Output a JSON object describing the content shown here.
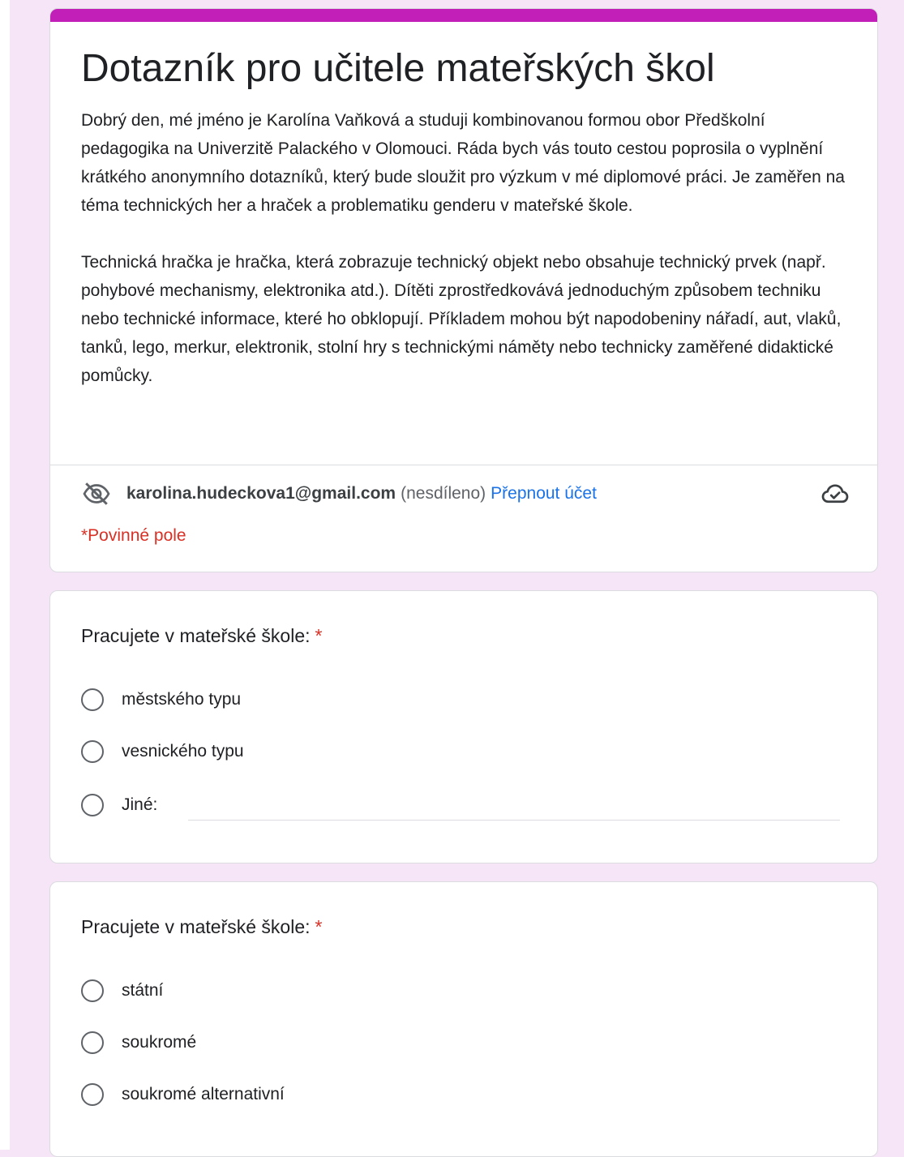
{
  "theme": {
    "accent": "#c21eb8",
    "background": "#f6e4f7",
    "link": "#1a73e8",
    "required": "#d93025"
  },
  "form": {
    "title": "Dotazník pro učitele mateřských škol",
    "description": [
      "Dobrý den, mé jméno je Karolína Vaňková a studuji kombinovanou formou obor Předškolní pedagogika na Univerzitě Palackého v Olomouci. Ráda bych vás touto cestou poprosila o vyplnění krátkého anonymního dotazníků, který bude sloužit pro výzkum v mé diplomové práci. Je zaměřen na téma technických her a hraček a problematiku genderu v mateřské škole.",
      "Technická hračka je hračka, která zobrazuje technický objekt nebo obsahuje technický prvek (např. pohybové mechanismy, elektronika atd.). Dítěti zprostředkovává jednoduchým způsobem techniku nebo technické informace, které ho obklopují. Příkladem mohou být napodobeniny nářadí, aut, vlaků, tanků, lego, merkur, elektronik, stolní hry s technickými náměty nebo technicky zaměřené didaktické pomůcky."
    ],
    "account": {
      "email": "karolina.hudeckova1@gmail.com",
      "note": "(nesdíleno)",
      "switch_label": "Přepnout účet",
      "hidden_icon": "eye-off-icon",
      "saved_icon": "cloud-check-icon"
    },
    "required_note": "*Povinné pole"
  },
  "questions": [
    {
      "title": "Pracujete v mateřské škole:",
      "required_mark": "*",
      "options": [
        "městského typu",
        "vesnického typu",
        "Jiné:"
      ],
      "other_value": ""
    },
    {
      "title": "Pracujete v mateřské škole:",
      "required_mark": "*",
      "options": [
        "státní",
        "soukromé",
        "soukromé alternativní"
      ]
    }
  ]
}
